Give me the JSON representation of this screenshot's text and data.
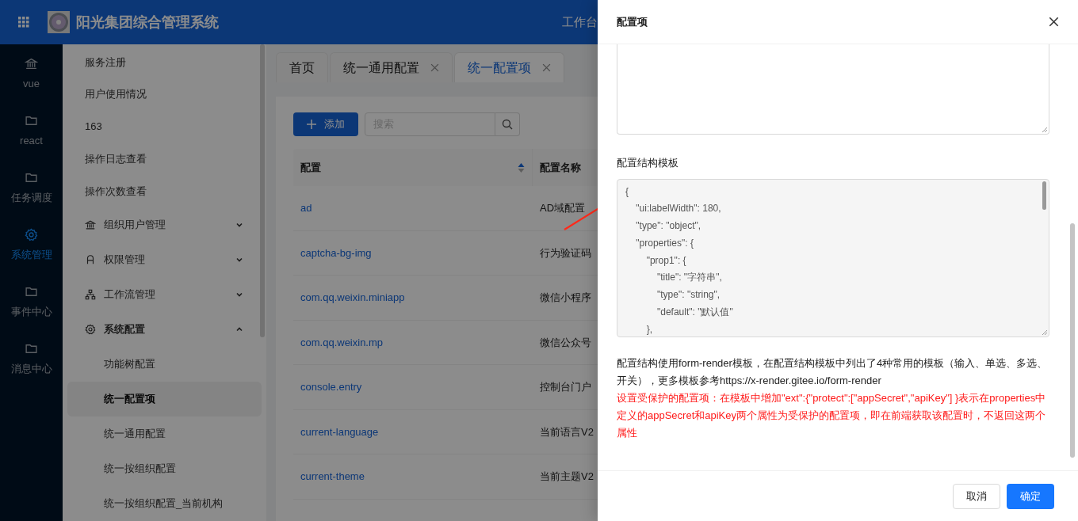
{
  "header": {
    "title": "阳光集团综合管理系统",
    "nav_item": "工作台"
  },
  "rail": [
    {
      "label": "vue",
      "kind": "bank",
      "selected": false
    },
    {
      "label": "react",
      "kind": "folder",
      "selected": false
    },
    {
      "label": "任务调度",
      "kind": "folder",
      "selected": false
    },
    {
      "label": "系统管理",
      "kind": "gear",
      "selected": true
    },
    {
      "label": "事件中心",
      "kind": "folder",
      "selected": false
    },
    {
      "label": "消息中心",
      "kind": "folder",
      "selected": false
    }
  ],
  "menu": [
    {
      "label": "服务注册",
      "kind": "item"
    },
    {
      "label": "用户使用情况",
      "kind": "item"
    },
    {
      "label": "163",
      "kind": "item"
    },
    {
      "label": "操作日志查看",
      "kind": "item"
    },
    {
      "label": "操作次数查看",
      "kind": "item"
    },
    {
      "label": "组织用户管理",
      "kind": "group-bank",
      "expanded": false
    },
    {
      "label": "权限管理",
      "kind": "group-user",
      "expanded": false
    },
    {
      "label": "工作流管理",
      "kind": "group-tree",
      "expanded": false
    },
    {
      "label": "系统配置",
      "kind": "group-gear",
      "expanded": true,
      "children": [
        {
          "label": "功能树配置",
          "selected": false
        },
        {
          "label": "统一配置项",
          "selected": true
        },
        {
          "label": "统一通用配置",
          "selected": false
        },
        {
          "label": "统一按组织配置",
          "selected": false
        },
        {
          "label": "统一按组织配置_当前机构",
          "selected": false
        }
      ]
    }
  ],
  "tabs": [
    {
      "label": "首页",
      "closable": false,
      "selected": false
    },
    {
      "label": "统一通用配置",
      "closable": true,
      "selected": false
    },
    {
      "label": "统一配置项",
      "closable": true,
      "selected": true
    }
  ],
  "toolbar": {
    "add_button": "添加",
    "search_placeholder": "搜索"
  },
  "table": {
    "columns": [
      {
        "label": "配置",
        "sortable": true
      },
      {
        "label": "配置名称"
      }
    ],
    "rows": [
      [
        "ad",
        "AD域配置"
      ],
      [
        "captcha-bg-img",
        "行为验证码"
      ],
      [
        "com.qq.weixin.miniapp",
        "微信小程序"
      ],
      [
        "com.qq.weixin.mp",
        "微信公众号"
      ],
      [
        "console.entry",
        "控制台门户"
      ],
      [
        "current-language",
        "当前语言V2"
      ],
      [
        "current-theme",
        "当前主题V2"
      ]
    ]
  },
  "drawer": {
    "title": "配置项",
    "template_label": "配置结构模板",
    "template_code": [
      "{",
      "    \"ui:labelWidth\": 180,",
      "    \"type\": \"object\",",
      "    \"properties\": {",
      "        \"prop1\": {",
      "            \"title\": \"字符串\",",
      "            \"type\": \"string\",",
      "            \"default\": \"默认值\"",
      "        },"
    ],
    "description": "配置结构使用form-render模板，在配置结构模板中列出了4种常用的模板（输入、单选、多选、开关），更多模板参考https://x-render.gitee.io/form-render",
    "note": "设置受保护的配置项：在模板中增加\"ext\":{\"protect\":[\"appSecret\",\"apiKey\"] }表示在properties中定义的appSecret和apiKey两个属性为受保护的配置项，即在前端获取该配置时，不返回这两个属性",
    "buttons": [
      {
        "label": "取消",
        "kind": "default"
      },
      {
        "label": "确定",
        "kind": "primary"
      }
    ]
  }
}
